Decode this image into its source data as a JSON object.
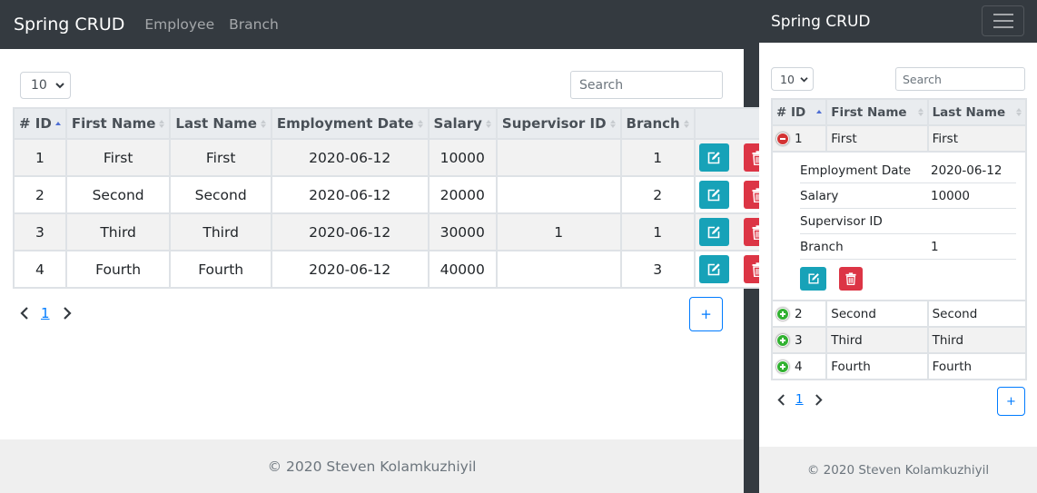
{
  "app": {
    "brand": "Spring CRUD"
  },
  "nav": {
    "items": [
      "Employee",
      "Branch"
    ]
  },
  "length_menu": {
    "value": "10"
  },
  "search": {
    "placeholder": "Search"
  },
  "table": {
    "headers": [
      "# ID",
      "First Name",
      "Last Name",
      "Employment Date",
      "Salary",
      "Supervisor ID",
      "Branch"
    ],
    "rows": [
      {
        "id": "1",
        "first": "First",
        "last": "First",
        "date": "2020-06-12",
        "salary": "10000",
        "supervisor": "",
        "branch": "1"
      },
      {
        "id": "2",
        "first": "Second",
        "last": "Second",
        "date": "2020-06-12",
        "salary": "20000",
        "supervisor": "",
        "branch": "2"
      },
      {
        "id": "3",
        "first": "Third",
        "last": "Third",
        "date": "2020-06-12",
        "salary": "30000",
        "supervisor": "1",
        "branch": "1"
      },
      {
        "id": "4",
        "first": "Fourth",
        "last": "Fourth",
        "date": "2020-06-12",
        "salary": "40000",
        "supervisor": "",
        "branch": "3"
      }
    ]
  },
  "mobile": {
    "detail": [
      {
        "label": "Employment Date",
        "value": "2020-06-12"
      },
      {
        "label": "Salary",
        "value": "10000"
      },
      {
        "label": "Supervisor ID",
        "value": ""
      },
      {
        "label": "Branch",
        "value": "1"
      }
    ]
  },
  "pagination": {
    "current": "1",
    "prev_icon": "chevron-left-icon",
    "next_icon": "chevron-right-icon"
  },
  "add_button": {
    "label": "+"
  },
  "footer": {
    "text": "© 2020 Steven Kolamkuzhiyil"
  },
  "colors": {
    "navbar": "#343a40",
    "edit": "#17a2b8",
    "delete": "#dc3545",
    "link": "#007bff",
    "footer_bg": "#efefef",
    "expand": "#31b131",
    "collapse": "#d33333"
  }
}
